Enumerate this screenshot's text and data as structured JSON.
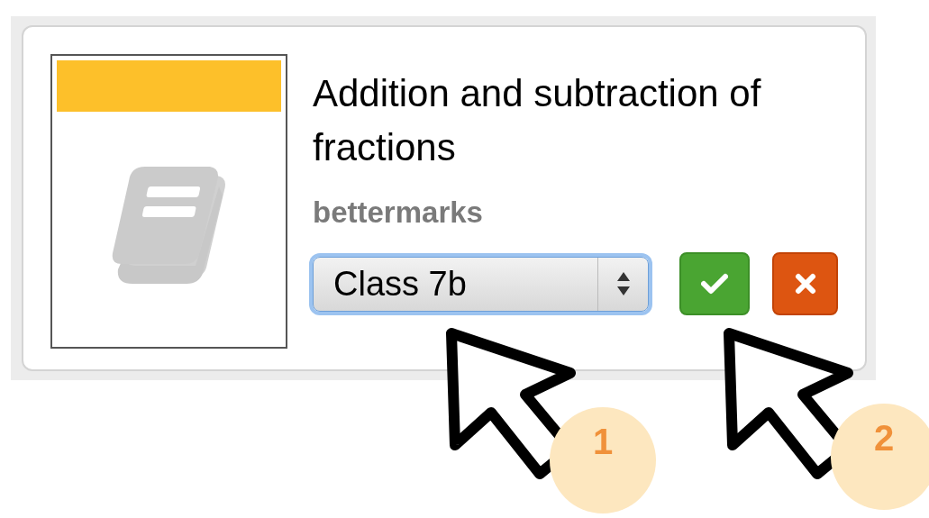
{
  "card": {
    "title": "Addition and subtraction of fractions",
    "source": "bettermarks",
    "class_select": {
      "value": "Class 7b",
      "focused": true
    },
    "buttons": [
      {
        "kind": "confirm"
      },
      {
        "kind": "cancel"
      }
    ]
  },
  "annotations": [
    {
      "label": "1",
      "kind": "select"
    },
    {
      "label": "2",
      "kind": "confirm"
    }
  ]
}
